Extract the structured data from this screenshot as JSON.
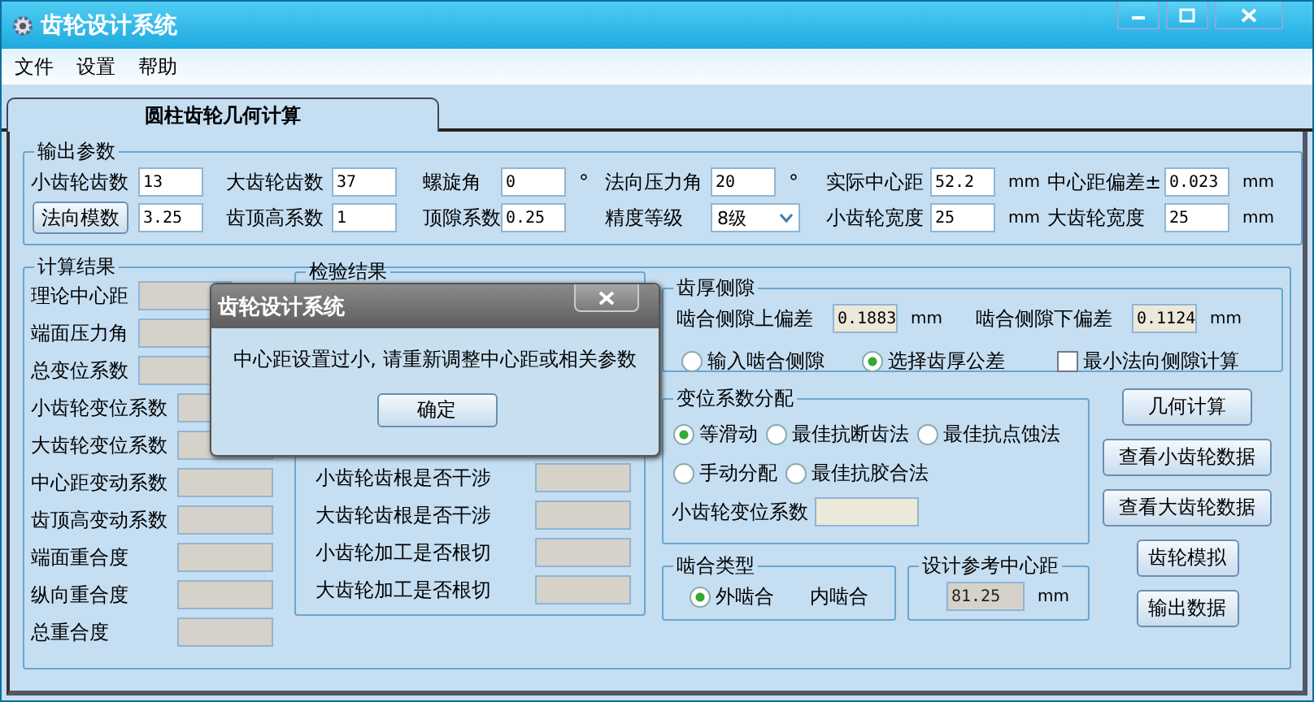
{
  "window": {
    "title": "齿轮设计系统"
  },
  "menu": [
    "文件",
    "设置",
    "帮助"
  ],
  "tabs": [
    {
      "label": "圆柱齿轮几何计算",
      "selected": true
    }
  ],
  "output_params": {
    "title": "输出参数",
    "rows": [
      [
        {
          "kind": "input",
          "label": "小齿轮齿数",
          "value": "13"
        },
        {
          "kind": "input",
          "label": "大齿轮齿数",
          "value": "37"
        },
        {
          "kind": "input",
          "label": "螺旋角",
          "value": "0",
          "unit": "°"
        },
        {
          "kind": "input",
          "label": "法向压力角",
          "value": "20",
          "unit": "°"
        },
        {
          "kind": "input",
          "label": "实际中心距",
          "value": "52.2",
          "unit": "mm"
        },
        {
          "kind": "input",
          "label": "中心距偏差±",
          "value": "0.023",
          "unit": "mm"
        }
      ],
      [
        {
          "kind": "button",
          "label": "法向模数",
          "value": "3.25"
        },
        {
          "kind": "input",
          "label": "齿顶高系数",
          "value": "1"
        },
        {
          "kind": "input",
          "label": "顶隙系数",
          "value": "0.25"
        },
        {
          "kind": "select",
          "label": "精度等级",
          "value": "8级"
        },
        {
          "kind": "input",
          "label": "小齿轮宽度",
          "value": "25",
          "unit": "mm"
        },
        {
          "kind": "input",
          "label": "大齿轮宽度",
          "value": "25",
          "unit": "mm"
        }
      ]
    ]
  },
  "results": {
    "title": "计算结果",
    "fields": [
      "理论中心距",
      "端面压力角",
      "总变位系数",
      "小齿轮变位系数",
      "大齿轮变位系数",
      "中心距变动系数",
      "齿顶高变动系数",
      "端面重合度",
      "纵向重合度",
      "总重合度"
    ]
  },
  "check": {
    "title": "检验结果",
    "fields": [
      "小齿轮齿根是否干涉",
      "大齿轮齿根是否干涉",
      "小齿轮加工是否根切",
      "大齿轮加工是否根切"
    ]
  },
  "backlash": {
    "title": "齿厚侧隙",
    "readings": [
      {
        "label": "啮合侧隙上偏差",
        "value": "0.1883",
        "unit": "mm"
      },
      {
        "label": "啮合侧隙下偏差",
        "value": "0.1124",
        "unit": "mm"
      }
    ],
    "options": [
      {
        "kind": "radio",
        "label": "输入啮合侧隙",
        "selected": false
      },
      {
        "kind": "radio",
        "label": "选择齿厚公差",
        "selected": true
      },
      {
        "kind": "checkbox",
        "label": "最小法向侧隙计算",
        "checked": false
      }
    ]
  },
  "shift": {
    "title": "变位系数分配",
    "option_rows": [
      [
        {
          "label": "等滑动",
          "selected": true
        },
        {
          "label": "最佳抗断齿法",
          "selected": false
        },
        {
          "label": "最佳抗点蚀法",
          "selected": false
        }
      ],
      [
        {
          "label": "手动分配",
          "selected": false
        },
        {
          "label": "最佳抗胶合法",
          "selected": false
        }
      ]
    ],
    "field_label": "小齿轮变位系数"
  },
  "mesh": {
    "title": "啮合类型",
    "options": [
      {
        "kind": "radio",
        "label": "外啮合",
        "selected": true
      },
      {
        "kind": "text",
        "label": "内啮合"
      }
    ]
  },
  "reference": {
    "title": "设计参考中心距",
    "value": "81.25",
    "unit": "mm"
  },
  "buttons": [
    "几何计算",
    "查看小齿轮数据",
    "查看大齿轮数据",
    "齿轮模拟",
    "输出数据"
  ],
  "dialog": {
    "title": "齿轮设计系统",
    "message": "中心距设置过小, 请重新调整中心距或相关参数",
    "button": "确定"
  }
}
